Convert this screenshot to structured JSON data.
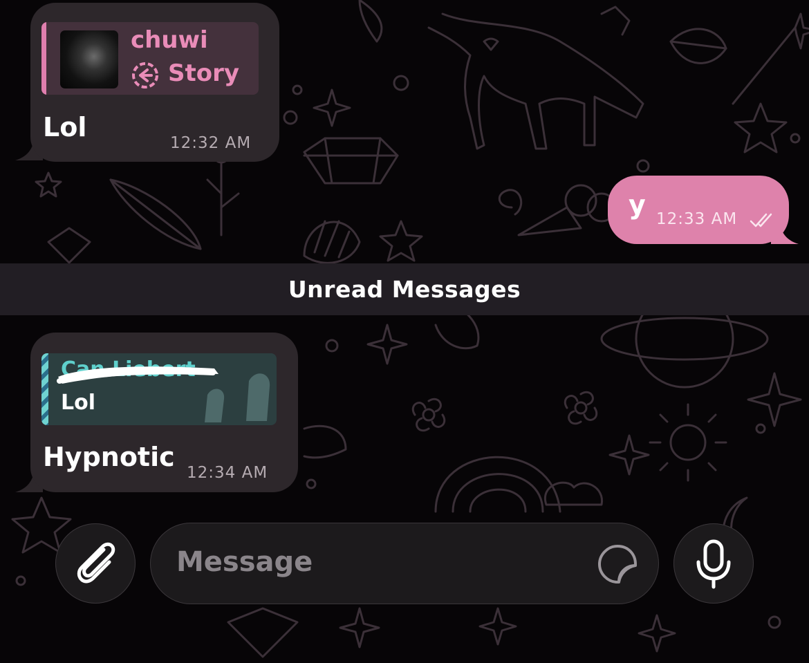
{
  "messages": [
    {
      "direction": "incoming",
      "reply": {
        "author": "chuwi",
        "type_label": "Story"
      },
      "text": "Lol",
      "time": "12:32 AM"
    },
    {
      "direction": "outgoing",
      "text": "y",
      "time": "12:33 AM",
      "status": "read"
    },
    {
      "direction": "incoming",
      "reply": {
        "author_redacted": "Can Liebert",
        "quoted_text": "Lol"
      },
      "text": "Hypnotic",
      "time": "12:34 AM"
    }
  ],
  "divider": {
    "label": "Unread Messages"
  },
  "composer": {
    "placeholder": "Message",
    "attach_icon": "paperclip-icon",
    "sticker_icon": "sticker-icon",
    "mic_icon": "microphone-icon"
  },
  "colors": {
    "background": "#070507",
    "incoming_bubble": "#2d272b",
    "outgoing_bubble": "#de82ab",
    "reply_accent": "#e07fae",
    "reply2_accent": "#5fd0cc"
  }
}
